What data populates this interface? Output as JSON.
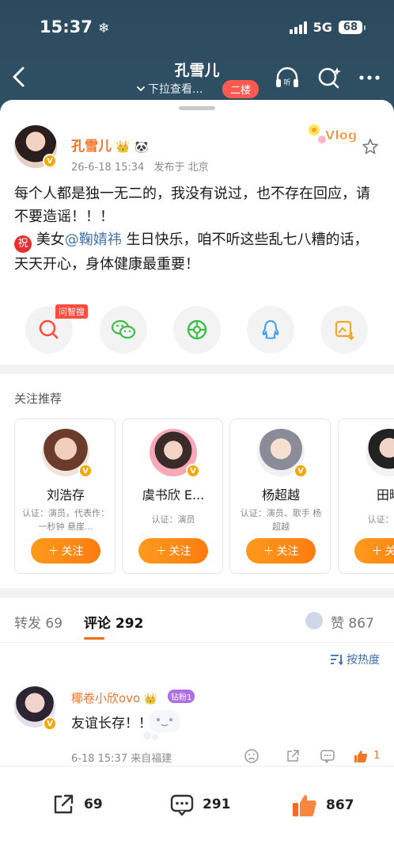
{
  "status_bar": {
    "time": "15:37",
    "snow": "❄",
    "network": "5G",
    "battery": "68"
  },
  "header": {
    "title": "孔雪儿",
    "pull_hint": "下拉查看...",
    "floor_badge": "二楼"
  },
  "post": {
    "author": "孔雪儿",
    "time": "26-6-18 15:34",
    "location": "发布于 北京",
    "line1": "每个人都是独一无二的，我没有说过，也不存在回应，请不要造谣！！！",
    "zhu": "祝",
    "line2_a": "美女",
    "mention": "@鞠婧祎",
    "line2_b": " 生日快乐，咱不听这些乱七八糟的话，天天开心，身体健康最重要！",
    "vlog_label": "Vlog"
  },
  "share": {
    "search_tag": "问智搜"
  },
  "recommend": {
    "title": "关注推荐",
    "follow_label": "关注",
    "cards": [
      {
        "name": "刘浩存",
        "desc": "认证：演员，代表作：一秒钟 悬崖..."
      },
      {
        "name": "虞书欣 E...",
        "desc": "认证：演员"
      },
      {
        "name": "杨超越",
        "desc": "认证：演员、歌手 杨超越"
      },
      {
        "name": "田曦",
        "desc": "认证：演员"
      }
    ]
  },
  "tabs": {
    "repost_label": "转发",
    "repost_count": "69",
    "comment_label": "评论",
    "comment_count": "292",
    "like_label": "赞",
    "like_count": "867"
  },
  "sort_label": "按热度",
  "comment": {
    "name": "椰卷小欣ovo",
    "fan_badge": "钻粉1",
    "text": "友谊长存！！！",
    "meta": "6-18 15:37 来自福建",
    "like_count": "1"
  },
  "bottom_bar": {
    "repost_count": "69",
    "comment_count": "291",
    "like_count": "867"
  },
  "colors": {
    "accent": "#f0742a",
    "link": "#3d73b3",
    "header_bg": "#2c4a5d"
  }
}
